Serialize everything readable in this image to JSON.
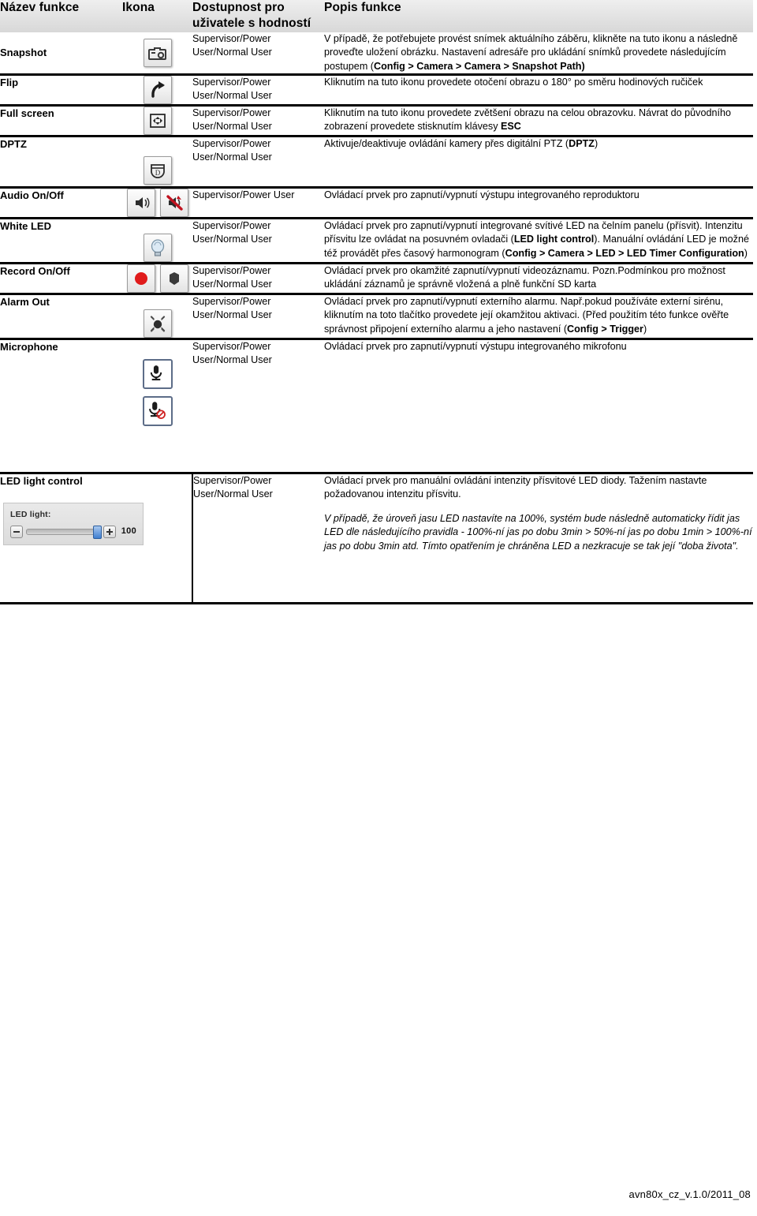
{
  "document": {
    "footer_code": "avn80x_cz_v.1.0/2011_08"
  },
  "table": {
    "headers": {
      "name": "Název funkce",
      "icon": "Ikona",
      "availability": "Dostupnost pro uživatele s hodností",
      "description": "Popis funkce"
    },
    "rows": [
      {
        "name": "Snapshot",
        "icon_names": [
          "snapshot-camera-icon"
        ],
        "availability": "Supervisor/Power User/Normal User",
        "desc_parts": [
          {
            "text": "V případě, že potřebujete provést snímek aktuálního záběru, klikněte na tuto ikonu a následně proveďte uložení obrázku. Nastavení adresáře pro ukládání snímků provedete následujícím postupem (",
            "style": "normal"
          },
          {
            "text": "Config > Camera > Camera > Snapshot Path)",
            "style": "bold"
          }
        ]
      },
      {
        "name": "Flip",
        "icon_names": [
          "flip-rotate-icon"
        ],
        "availability": "Supervisor/Power User/Normal User",
        "desc_parts": [
          {
            "text": "Kliknutím na tuto ikonu provedete otočení obrazu o 180° po směru hodinových ručiček",
            "style": "normal"
          }
        ]
      },
      {
        "name": "Full screen",
        "icon_names": [
          "fullscreen-expand-icon"
        ],
        "availability": "Supervisor/Power User/Normal User",
        "desc_parts": [
          {
            "text": "Kliknutím na tuto ikonu provedete zvětšení obrazu na celou obrazovku. Návrat do původního zobrazení  provedete stisknutím klávesy ",
            "style": "normal"
          },
          {
            "text": "ESC",
            "style": "bold"
          }
        ]
      },
      {
        "name": "DPTZ",
        "icon_names": [
          "dptz-icon"
        ],
        "availability": "Supervisor/Power User/Normal User",
        "desc_parts": [
          {
            "text": "Aktivuje/deaktivuje ovládání kamery přes digitální PTZ (",
            "style": "normal"
          },
          {
            "text": "DPTZ",
            "style": "bold"
          },
          {
            "text": ")",
            "style": "normal"
          }
        ]
      },
      {
        "name": "Audio On/Off",
        "icon_names": [
          "speaker-on-icon",
          "speaker-muted-icon"
        ],
        "availability": "Supervisor/Power User",
        "desc_parts": [
          {
            "text": "Ovládací prvek pro zapnutí/vypnutí výstupu integrovaného reproduktoru",
            "style": "normal"
          }
        ]
      },
      {
        "name": "White LED",
        "icon_names": [
          "white-led-bulb-icon"
        ],
        "availability": "Supervisor/Power User/Normal User",
        "desc_parts": [
          {
            "text": "Ovládací prvek pro zapnutí/vypnutí integrované svítivé LED na čelním panelu (přísvit).  Intenzitu přísvitu lze ovládat na posuvném ovladači (",
            "style": "normal"
          },
          {
            "text": "LED light control",
            "style": "bold"
          },
          {
            "text": "). Manuální ovládání LED je možné též provádět přes časový harmonogram (",
            "style": "normal"
          },
          {
            "text": "Config > Camera > LED > LED Timer Configuration",
            "style": "bold"
          },
          {
            "text": ")",
            "style": "normal"
          }
        ]
      },
      {
        "name": "Record On/Off",
        "icon_names": [
          "record-on-icon",
          "record-off-icon"
        ],
        "availability": "Supervisor/Power User/Normal User",
        "desc_parts": [
          {
            "text": "Ovládací prvek pro okamžité zapnutí/vypnutí videozáznamu. Pozn.Podmínkou pro možnost ukládání záznamů je správně vložená a plně funkční SD karta",
            "style": "normal"
          }
        ]
      },
      {
        "name": "Alarm Out",
        "icon_names": [
          "alarm-out-siren-icon"
        ],
        "availability": "Supervisor/Power User/Normal User",
        "desc_parts": [
          {
            "text": "Ovládací prvek pro zapnutí/vypnutí externího alarmu. Např.pokud používáte externí sirénu, kliknutím na  toto tlačítko provedete její okamžitou aktivaci. (Před použitím této funkce ověřte správnost připojení externího alarmu a jeho nastavení (",
            "style": "normal"
          },
          {
            "text": "Config > Trigger",
            "style": "bold"
          },
          {
            "text": ")",
            "style": "normal"
          }
        ]
      },
      {
        "name": "Microphone",
        "icon_names": [
          "microphone-on-icon",
          "microphone-muted-icon"
        ],
        "availability": "Supervisor/Power User/Normal User",
        "desc_parts": [
          {
            "text": "Ovládací prvek pro zapnutí/vypnutí výstupu integrovaného mikrofonu",
            "style": "normal"
          }
        ]
      },
      {
        "name": "LED light control",
        "icon_names": [],
        "availability": "Supervisor/Power User/Normal User",
        "desc_parts": [
          {
            "text": "Ovládací prvek pro manuální ovládání intenzity přísvitové LED diody. Tažením nastavte požadovanou intenzitu přísvitu.",
            "style": "normal"
          },
          {
            "text": "PARA",
            "style": "break"
          },
          {
            "text": "V případě, že úroveň jasu LED nastavíte na 100%, systém bude následně automaticky řídit jas LED dle následujícího pravidla - 100%-ní jas po dobu 3min > 50%-ní jas po dobu 1min > 100%-ní jas po dobu 3min atd. Tímto opatřením je chráněna LED a nezkracuje se tak její \"doba života\".",
            "style": "italic"
          }
        ]
      }
    ]
  },
  "led_widget": {
    "label": "LED light:",
    "value": "100",
    "minus_label": "−",
    "plus_label": "+"
  }
}
